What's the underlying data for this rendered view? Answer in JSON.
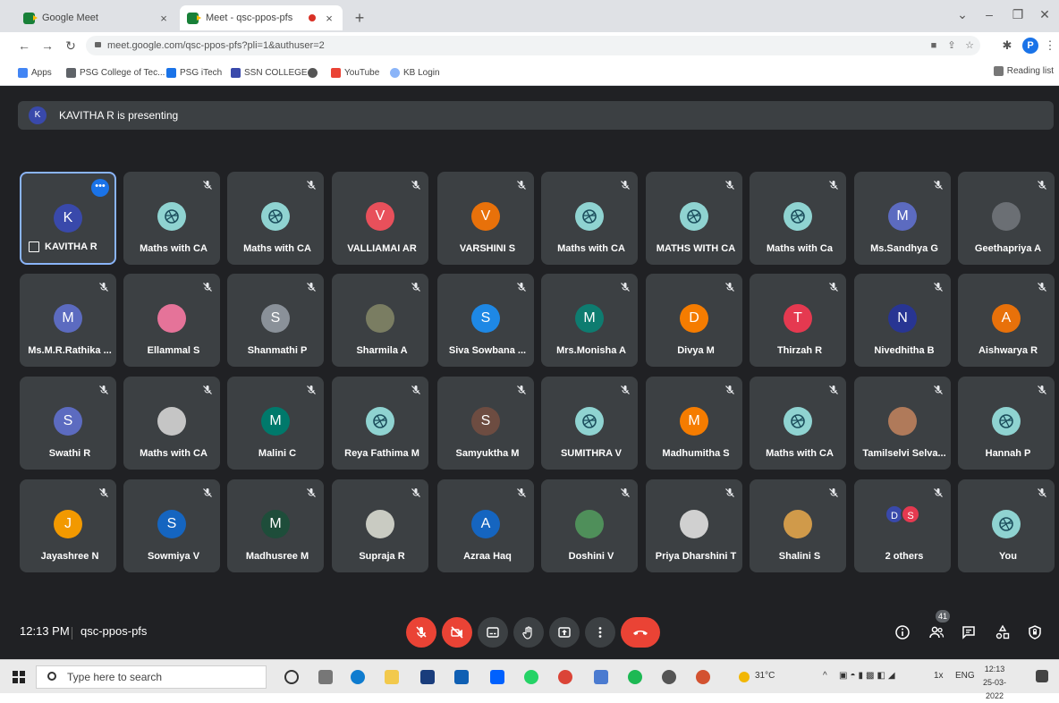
{
  "browser": {
    "tabs": [
      {
        "title": "Google Meet",
        "active": false
      },
      {
        "title": "Meet - qsc-ppos-pfs",
        "active": true
      }
    ],
    "url": "meet.google.com/qsc-ppos-pfs?pli=1&authuser=2",
    "profile_initial": "P",
    "bookmarks": [
      {
        "label": "Apps",
        "color": "#4285f4"
      },
      {
        "label": "PSG College of Tec...",
        "color": "#5f6368"
      },
      {
        "label": "PSG iTech",
        "color": "#1a73e8"
      },
      {
        "label": "SSN COLLEGE",
        "color": "#3949ab"
      },
      {
        "label": "",
        "color": "#555555"
      },
      {
        "label": "YouTube",
        "color": "#ea4335"
      },
      {
        "label": "KB Login",
        "color": "#8ab4f8"
      }
    ],
    "reading_list": "Reading list"
  },
  "meet": {
    "presenting": {
      "initial": "K",
      "text": "KAVITHA R is presenting"
    },
    "participants": [
      {
        "name": "KAVITHA R",
        "initial": "K",
        "color": "#3949ab",
        "type": "letter",
        "presenter": true
      },
      {
        "name": "Maths with CA",
        "type": "logo"
      },
      {
        "name": "Maths with CA",
        "type": "logo"
      },
      {
        "name": "VALLIAMAI AR",
        "initial": "V",
        "color": "#e8505b",
        "type": "letter"
      },
      {
        "name": "VARSHINI S",
        "initial": "V",
        "color": "#e8710a",
        "type": "letter"
      },
      {
        "name": "Maths with CA",
        "type": "logo"
      },
      {
        "name": "MATHS WITH CA",
        "type": "logo"
      },
      {
        "name": "Maths with Ca",
        "type": "logo"
      },
      {
        "name": "Ms.Sandhya G",
        "initial": "M",
        "color": "#5c6bc0",
        "type": "letter"
      },
      {
        "name": "Geethapriya A",
        "type": "photo",
        "color": "#6b6f74"
      },
      {
        "name": "Ms.M.R.Rathika ...",
        "initial": "M",
        "color": "#5c6bc0",
        "type": "letter"
      },
      {
        "name": "Ellammal S",
        "type": "photo",
        "color": "#e57399"
      },
      {
        "name": "Shanmathi P",
        "initial": "S",
        "color": "#8a9199",
        "type": "letter"
      },
      {
        "name": "Sharmila A",
        "type": "photo",
        "color": "#7a7d62"
      },
      {
        "name": "Siva Sowbana ...",
        "initial": "S",
        "color": "#1e88e5",
        "type": "letter"
      },
      {
        "name": "Mrs.Monisha A",
        "initial": "M",
        "color": "#0e7c70",
        "type": "letter"
      },
      {
        "name": "Divya M",
        "initial": "D",
        "color": "#f57c00",
        "type": "letter"
      },
      {
        "name": "Thirzah R",
        "initial": "T",
        "color": "#e53950",
        "type": "letter"
      },
      {
        "name": "Nivedhitha B",
        "initial": "N",
        "color": "#283593",
        "type": "letter"
      },
      {
        "name": "Aishwarya R",
        "initial": "A",
        "color": "#e8710a",
        "type": "letter"
      },
      {
        "name": "Swathi R",
        "initial": "S",
        "color": "#5c6bc0",
        "type": "letter"
      },
      {
        "name": "Maths with CA",
        "type": "photo",
        "color": "#c5c5c5"
      },
      {
        "name": "Malini C",
        "initial": "M",
        "color": "#00796b",
        "type": "letter"
      },
      {
        "name": "Reya Fathima M",
        "type": "logo"
      },
      {
        "name": "Samyuktha M",
        "initial": "S",
        "color": "#6d4c41",
        "type": "letter"
      },
      {
        "name": "SUMITHRA V",
        "type": "logo"
      },
      {
        "name": "Madhumitha S",
        "initial": "M",
        "color": "#f57c00",
        "type": "letter"
      },
      {
        "name": "Maths with CA",
        "type": "logo"
      },
      {
        "name": "Tamilselvi Selva...",
        "type": "photo",
        "color": "#b07a5a"
      },
      {
        "name": "Hannah P",
        "type": "logo"
      },
      {
        "name": "Jayashree N",
        "initial": "J",
        "color": "#f29900",
        "type": "letter"
      },
      {
        "name": "Sowmiya V",
        "initial": "S",
        "color": "#1565c0",
        "type": "letter"
      },
      {
        "name": "Madhusree M",
        "initial": "M",
        "color": "#1e4d3a",
        "type": "letter"
      },
      {
        "name": "Supraja R",
        "type": "photo",
        "color": "#c9cbc2"
      },
      {
        "name": "Azraa Haq",
        "initial": "A",
        "color": "#1565c0",
        "type": "letter"
      },
      {
        "name": "Doshini V",
        "type": "photo",
        "color": "#4f8f5a"
      },
      {
        "name": "Priya Dharshini T",
        "type": "photo",
        "color": "#d0d0d0"
      },
      {
        "name": "Shalini S",
        "type": "photo",
        "color": "#d09a4a"
      },
      {
        "name": "2 others",
        "type": "others",
        "avatars": [
          {
            "initial": "D",
            "color": "#3949ab"
          },
          {
            "initial": "S",
            "color": "#e53950"
          }
        ]
      },
      {
        "name": "You",
        "type": "logo"
      }
    ],
    "time": "12:13 PM",
    "meeting_code": "qsc-ppos-pfs",
    "people_count": "41"
  },
  "taskbar": {
    "search_placeholder": "Type here to search",
    "weather": "31°C",
    "language": "ENG",
    "time": "12:13",
    "date": "25-03-2022",
    "volume_label": "1x"
  }
}
